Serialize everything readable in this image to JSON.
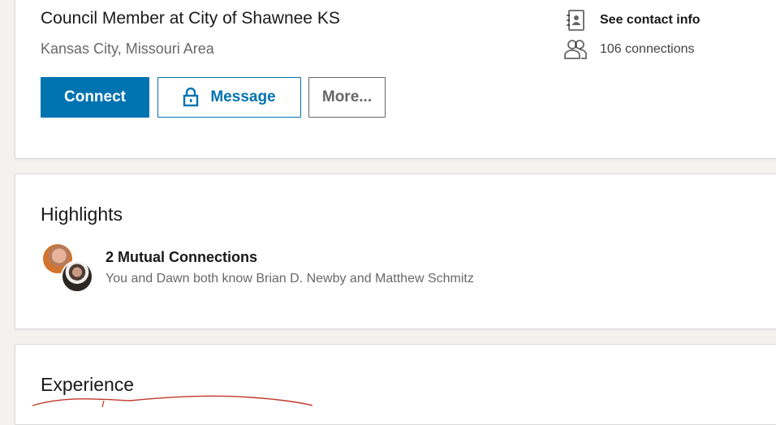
{
  "profile": {
    "headline": "Council Member at City of Shawnee KS",
    "location": "Kansas City, Missouri Area"
  },
  "actions": {
    "connect_label": "Connect",
    "message_label": "Message",
    "more_label": "More..."
  },
  "sidebar": {
    "contact_label": "See contact info",
    "connections_label": "106 connections"
  },
  "highlights": {
    "title": "Highlights",
    "mutual_title": "2 Mutual Connections",
    "mutual_subtitle": "You and Dawn both know Brian D. Newby and Matthew Schmitz"
  },
  "experience": {
    "title": "Experience"
  },
  "colors": {
    "primary": "#0073b1",
    "background": "#f3f2ef",
    "scribble": "#c0392b"
  },
  "icons": {
    "contact": "contact-card-icon",
    "connections": "people-icon",
    "message": "lock-icon"
  }
}
